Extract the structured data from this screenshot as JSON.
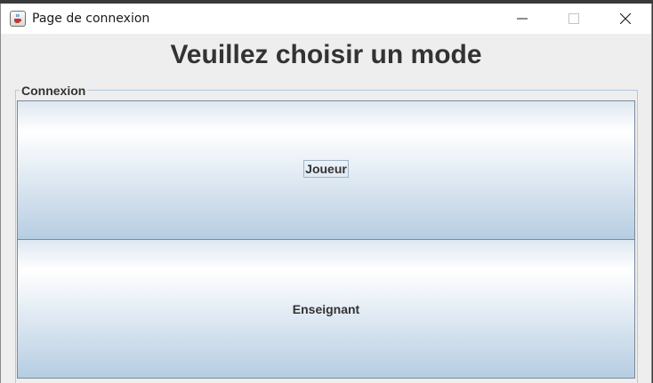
{
  "window": {
    "title": "Page de connexion",
    "app_icon": "java-cup-icon",
    "controls": [
      "minimize-icon",
      "maximize-icon",
      "close-icon"
    ]
  },
  "main": {
    "heading": "Veuillez choisir un mode",
    "group_title": "Connexion",
    "buttons": [
      {
        "label": "Joueur",
        "focused": true
      },
      {
        "label": "Enseignant",
        "focused": false
      }
    ]
  },
  "colors": {
    "window_background": "#eeeeee",
    "text": "#333333",
    "button_gradient_top": "#ffffff",
    "button_gradient_bottom": "#b6cde2",
    "group_border": "#b4c8dc"
  }
}
